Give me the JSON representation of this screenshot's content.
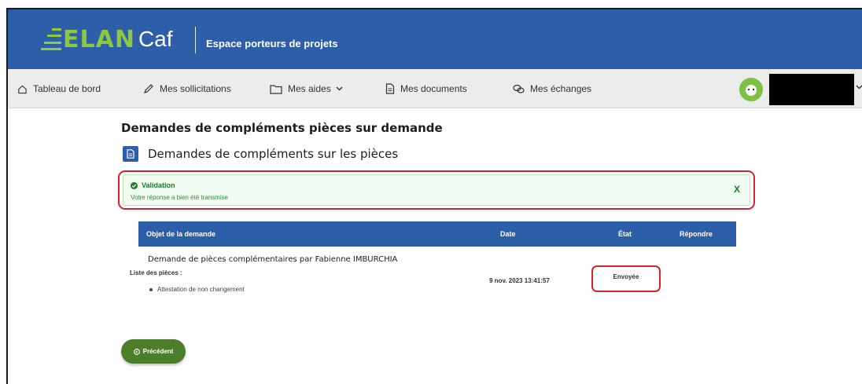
{
  "header": {
    "logo_elan": "ELAN",
    "logo_caf": "Caf",
    "title": "Espace porteurs de projets"
  },
  "nav": {
    "items": [
      {
        "label": "Tableau de bord",
        "icon": "home-icon"
      },
      {
        "label": "Mes sollicitations",
        "icon": "pen-icon"
      },
      {
        "label": "Mes aides",
        "icon": "folder-icon"
      },
      {
        "label": "Mes documents",
        "icon": "document-icon"
      },
      {
        "label": "Mes échanges",
        "icon": "chat-icon"
      }
    ]
  },
  "page": {
    "title": "Demandes de compléments pièces sur demande",
    "section_title": "Demandes de compléments sur les pièces"
  },
  "alert": {
    "title": "Validation",
    "message": "Votre réponse a bien été transmise",
    "close": "X"
  },
  "table": {
    "columns": [
      "Objet de la demande",
      "Date",
      "État",
      "Répondre"
    ],
    "rows": [
      {
        "title": "Demande de pièces complémentaires par Fabienne IMBURCHIA",
        "list_label": "Liste des pièces :",
        "items": [
          "Attestation de non changement"
        ],
        "date": "9 nov. 2023 13:41:57",
        "state": "Envoyée"
      }
    ]
  },
  "buttons": {
    "previous": "Précédent"
  },
  "colors": {
    "primary": "#2d5ea8",
    "accent_green": "#8fc73e",
    "button_green": "#4c7d2b",
    "highlight_red": "#d2252b",
    "success_text": "#1e7a2e"
  }
}
